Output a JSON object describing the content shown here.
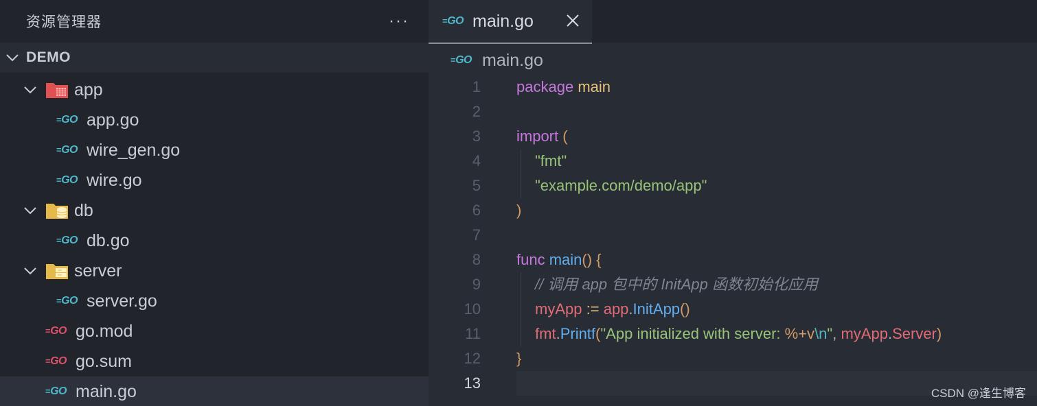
{
  "sidebar": {
    "title": "资源管理器",
    "more": "···",
    "section": "DEMO",
    "tree": [
      {
        "label": "app",
        "kind": "folder-red"
      },
      {
        "label": "app.go",
        "kind": "go-file"
      },
      {
        "label": "wire_gen.go",
        "kind": "go-file"
      },
      {
        "label": "wire.go",
        "kind": "go-file"
      },
      {
        "label": "db",
        "kind": "folder-db"
      },
      {
        "label": "db.go",
        "kind": "go-file"
      },
      {
        "label": "server",
        "kind": "folder-server"
      },
      {
        "label": "server.go",
        "kind": "go-file"
      },
      {
        "label": "go.mod",
        "kind": "go-mod"
      },
      {
        "label": "go.sum",
        "kind": "go-mod"
      },
      {
        "label": "main.go",
        "kind": "go-file",
        "selected": true
      }
    ]
  },
  "icons": {
    "go_text": "GO",
    "go_dash": "="
  },
  "editor": {
    "tab_label": "main.go",
    "breadcrumb": "main.go",
    "lines": [
      {
        "n": "1"
      },
      {
        "n": "2"
      },
      {
        "n": "3"
      },
      {
        "n": "4"
      },
      {
        "n": "5"
      },
      {
        "n": "6"
      },
      {
        "n": "7"
      },
      {
        "n": "8"
      },
      {
        "n": "9"
      },
      {
        "n": "10"
      },
      {
        "n": "11"
      },
      {
        "n": "12"
      },
      {
        "n": "13"
      }
    ],
    "code": {
      "l1_kw": "package",
      "l1_name": "main",
      "l3_kw": "import",
      "l3_paren": "(",
      "l4_str": "\"fmt\"",
      "l5_str": "\"example.com/demo/app\"",
      "l6_paren": ")",
      "l8_kw": "func",
      "l8_fn": "main",
      "l8_rest": "() {",
      "l9_cmt": "// 调用 app 包中的 InitApp 函数初始化应用",
      "l10_var": "myApp",
      "l10_op": ":=",
      "l10_pkg": "app",
      "l10_dot": ".",
      "l10_fn": "InitApp",
      "l10_paren": "()",
      "l11_pkg": "fmt",
      "l11_dot": ".",
      "l11_fn": "Printf",
      "l11_open": "(",
      "l11_str1": "\"App initialized with server: ",
      "l11_fmt": "%+v",
      "l11_esc": "\\n",
      "l11_str2": "\"",
      "l11_comma": ", ",
      "l11_var": "myApp",
      "l11_dot2": ".",
      "l11_field": "Server",
      "l11_close": ")",
      "l12_brace": "}"
    }
  },
  "watermark": "CSDN @逢生博客"
}
